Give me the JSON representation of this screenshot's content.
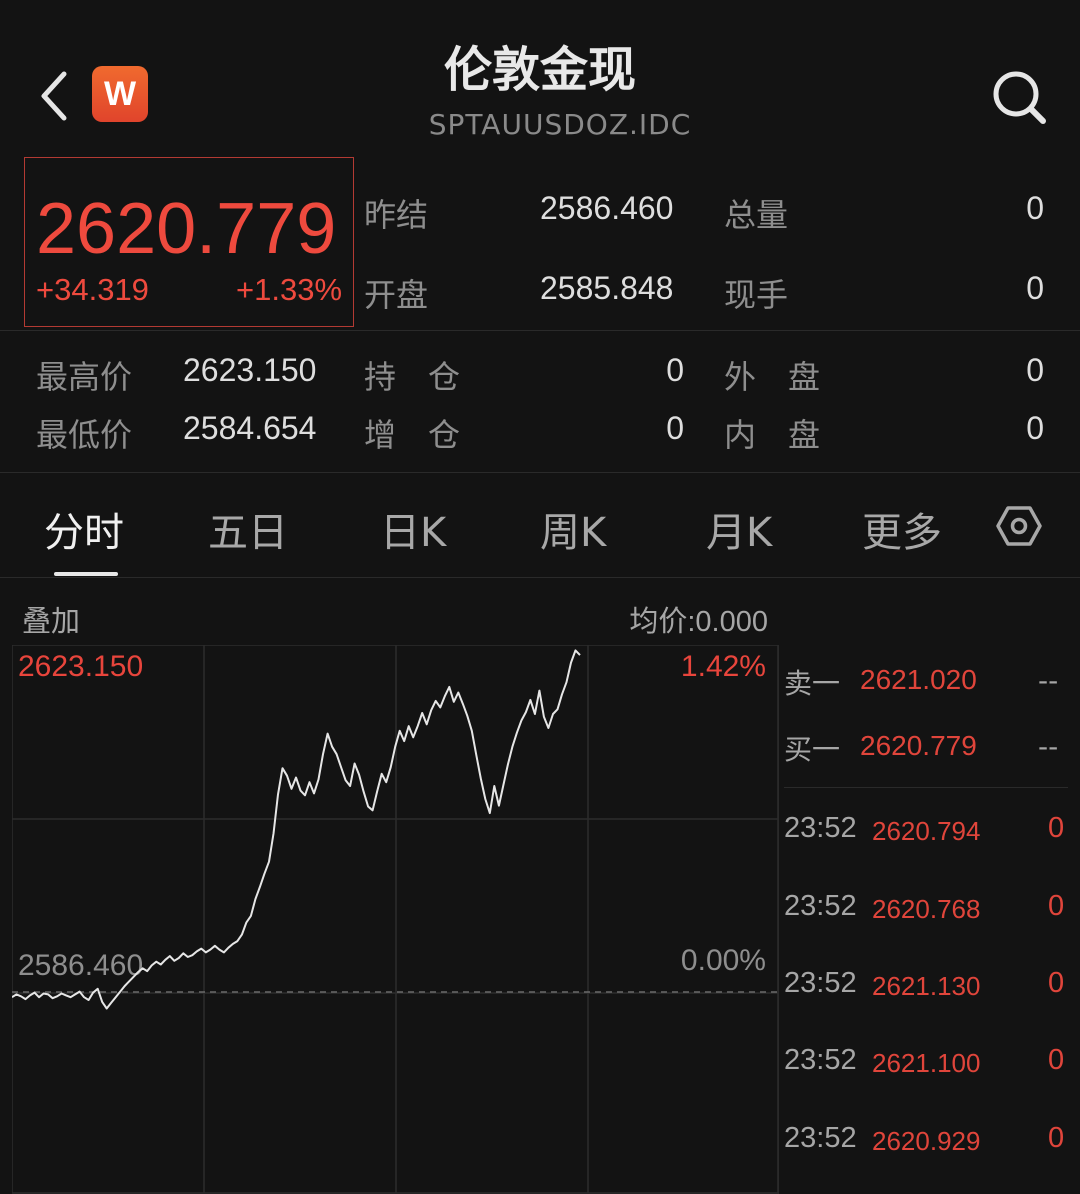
{
  "header": {
    "title": "伦敦金现",
    "subtitle": "SPTAUUSDOZ.IDC",
    "logo_letter": "W"
  },
  "quote": {
    "price": "2620.779",
    "change": "+34.319",
    "change_pct": "+1.33%",
    "fields": {
      "prev_settle_label": "昨结",
      "prev_settle": "2586.460",
      "volume_label": "总量",
      "volume": "0",
      "open_label": "开盘",
      "open": "2585.848",
      "current_hand_label": "现手",
      "current_hand": "0",
      "high_label": "最高价",
      "high": "2623.150",
      "low_label": "最低价",
      "low": "2584.654",
      "open_interest_label": "持　仓",
      "open_interest": "0",
      "oi_change_label": "增　仓",
      "oi_change": "0",
      "outer_label": "外　盘",
      "outer": "0",
      "inner_label": "内　盘",
      "inner": "0"
    }
  },
  "tabs": [
    "分时",
    "五日",
    "日K",
    "周K",
    "月K",
    "更多"
  ],
  "chart_toolbar": {
    "overlay_label": "叠加",
    "avg_price": "均价:0.000"
  },
  "chart_data": {
    "type": "line",
    "top_price_label": "2623.150",
    "top_pct_label": "1.42%",
    "base_price_label": "2586.460",
    "base_pct_label": "0.00%",
    "ylim": [
      2586.46,
      2623.15
    ],
    "y_values": [
      2585.9,
      2586.2,
      2586.0,
      2585.7,
      2586.1,
      2586.4,
      2585.9,
      2586.3,
      2586.2,
      2585.8,
      2586.0,
      2586.3,
      2586.1,
      2585.9,
      2586.2,
      2586.5,
      2585.9,
      2585.6,
      2586.4,
      2586.8,
      2585.4,
      2584.7,
      2585.3,
      2585.9,
      2586.5,
      2587.1,
      2587.6,
      2588.1,
      2588.6,
      2589.0,
      2588.7,
      2589.3,
      2589.7,
      2589.4,
      2589.9,
      2590.3,
      2589.8,
      2590.1,
      2590.6,
      2590.2,
      2590.4,
      2590.8,
      2591.1,
      2590.7,
      2591.0,
      2591.4,
      2591.0,
      2590.7,
      2591.2,
      2591.6,
      2591.9,
      2592.6,
      2593.9,
      2594.6,
      2596.4,
      2597.7,
      2599.1,
      2600.4,
      2603.4,
      2607.6,
      2610.4,
      2609.6,
      2608.2,
      2609.4,
      2608.0,
      2607.5,
      2608.9,
      2607.7,
      2609.2,
      2611.9,
      2614.1,
      2612.7,
      2611.9,
      2610.5,
      2609.1,
      2608.5,
      2610.9,
      2609.7,
      2607.9,
      2606.3,
      2605.9,
      2607.9,
      2609.8,
      2608.9,
      2610.5,
      2612.7,
      2614.4,
      2613.3,
      2614.9,
      2613.7,
      2614.9,
      2616.3,
      2615.1,
      2616.6,
      2617.6,
      2616.9,
      2618.1,
      2619.1,
      2617.5,
      2618.5,
      2617.3,
      2616.0,
      2614.4,
      2611.8,
      2609.3,
      2607.1,
      2605.6,
      2608.5,
      2606.4,
      2608.6,
      2610.8,
      2612.7,
      2614.2,
      2615.5,
      2616.4,
      2617.7,
      2616.2,
      2618.7,
      2615.9,
      2614.7,
      2616.2,
      2616.7,
      2618.3,
      2619.6,
      2621.7,
      2623.0,
      2622.5
    ]
  },
  "order_book": [
    {
      "label": "卖一",
      "price": "2621.020",
      "volume": "--"
    },
    {
      "label": "买一",
      "price": "2620.779",
      "volume": "--"
    }
  ],
  "ticks": [
    {
      "time": "23:52",
      "price": "2620.794",
      "volume": "0"
    },
    {
      "time": "23:52",
      "price": "2620.768",
      "volume": "0"
    },
    {
      "time": "23:52",
      "price": "2621.130",
      "volume": "0"
    },
    {
      "time": "23:52",
      "price": "2621.100",
      "volume": "0"
    },
    {
      "time": "23:52",
      "price": "2620.929",
      "volume": "0"
    }
  ],
  "colors": {
    "up": "#e8453c",
    "background": "#131313",
    "line": "#e6e6e6"
  }
}
